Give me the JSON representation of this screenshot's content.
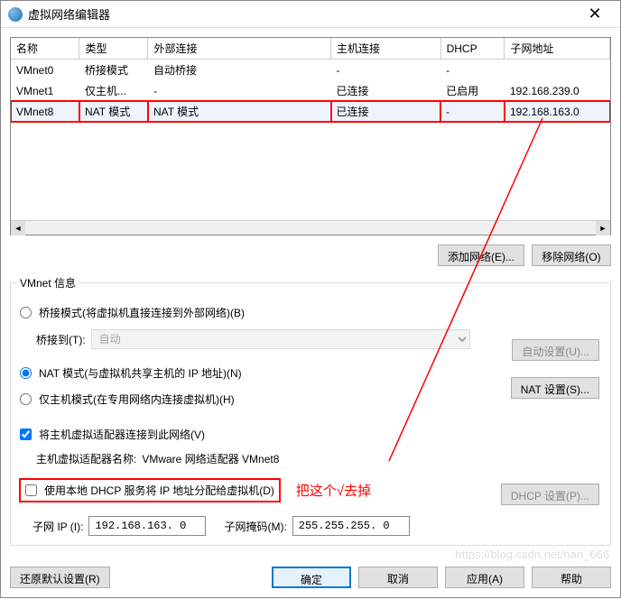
{
  "window": {
    "title": "虚拟网络编辑器"
  },
  "table": {
    "headers": [
      "名称",
      "类型",
      "外部连接",
      "主机连接",
      "DHCP",
      "子网地址"
    ],
    "rows": [
      {
        "name": "VMnet0",
        "type": "桥接模式",
        "ext": "自动桥接",
        "host": "-",
        "dhcp": "-",
        "subnet": ""
      },
      {
        "name": "VMnet1",
        "type": "仅主机...",
        "ext": "-",
        "host": "已连接",
        "dhcp": "已启用",
        "subnet": "192.168.239.0"
      },
      {
        "name": "VMnet8",
        "type": "NAT 模式",
        "ext": "NAT 模式",
        "host": "已连接",
        "dhcp": "-",
        "subnet": "192.168.163.0"
      }
    ]
  },
  "buttons": {
    "add_network": "添加网络(E)...",
    "remove_network": "移除网络(O)",
    "auto_settings": "自动设置(U)...",
    "nat_settings": "NAT 设置(S)...",
    "dhcp_settings": "DHCP 设置(P)...",
    "restore_defaults": "还原默认设置(R)",
    "ok": "确定",
    "cancel": "取消",
    "apply": "应用(A)",
    "help": "帮助"
  },
  "info": {
    "legend": "VMnet 信息",
    "mode_bridge": "桥接模式(将虚拟机直接连接到外部网络)(B)",
    "bridge_to_label": "桥接到(T):",
    "bridge_to_value": "自动",
    "mode_nat": "NAT 模式(与虚拟机共享主机的 IP 地址)(N)",
    "mode_host": "仅主机模式(在专用网络内连接虚拟机)(H)",
    "connect_host": "将主机虚拟适配器连接到此网络(V)",
    "adapter_name_label": "主机虚拟适配器名称: ",
    "adapter_name_value": "VMware 网络适配器 VMnet8",
    "use_dhcp": "使用本地 DHCP 服务将 IP 地址分配给虚拟机(D)",
    "annotation": "把这个√去掉",
    "subnet_ip_label": "子网 IP (I):",
    "subnet_ip_value": "192.168.163. 0",
    "subnet_mask_label": "子网掩码(M):",
    "subnet_mask_value": "255.255.255. 0"
  },
  "watermark": "https://blog.csdn.net/nan_666"
}
